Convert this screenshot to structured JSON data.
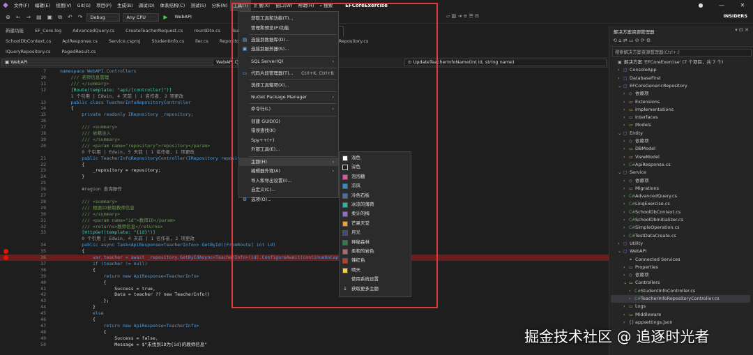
{
  "menubar": {
    "items": [
      "文件(F)",
      "编辑(E)",
      "视图(V)",
      "Git(G)",
      "项目(P)",
      "生成(B)",
      "调试(D)",
      "体系结构(C)",
      "测试(S)",
      "分析(N)",
      "工具(T)",
      "扩展(X)",
      "窗口(W)",
      "帮助(H)"
    ],
    "search": "搜索",
    "title": "EFCoreExercise"
  },
  "toolbar": {
    "config": "Debug",
    "platform": "Any CPU",
    "project": "WebAPI",
    "insiders": "INSIDERS"
  },
  "tabs_row1": [
    "新建功能",
    "EF_Core.log",
    "AdvancedQuery.cs",
    "CreateTeacherRequest.cs",
    "rountDto.cs",
    "TeacherInfo.cs",
    "TeacherInfoR...Controller.cs"
  ],
  "tabs_row2": [
    "SchoolDbContext.cs",
    "ApiResponse.cs",
    "Service.csproj",
    "StudentInfo.cs",
    "ller.cs",
    "Repository.cs",
    "ServiceCollec...Extensions.cs",
    "IRepository.cs"
  ],
  "tabs_row3": [
    "IQueryRepository.cs",
    "PagedResult.cs"
  ],
  "navbar": {
    "project": "WebAPI",
    "class": "WebAPI.C",
    "member": "UpdateTeacherInfoName(int id, string name)"
  },
  "code_lines": [
    {
      "n": "7",
      "t": "namespace WebAPI.Controllers"
    },
    {
      "n": "10",
      "t": "    /// 老师信息管理"
    },
    {
      "n": "11",
      "t": "    /// </summary>"
    },
    {
      "n": "12",
      "t": "    [Route(template: \"api/[controller]\")]"
    },
    {
      "n": "",
      "t": "    1 个引用 | Edwin, 4 天前 | 1 名作者, 2 项更改"
    },
    {
      "n": "13",
      "t": "    public class TeacherInfoRepositoryController"
    },
    {
      "n": "14",
      "t": "    {"
    },
    {
      "n": "15",
      "t": "        private readonly IRepository _repository;"
    },
    {
      "n": "16",
      "t": ""
    },
    {
      "n": "17",
      "t": "        /// <summary>"
    },
    {
      "n": "18",
      "t": "        /// 依赖注入"
    },
    {
      "n": "19",
      "t": "        /// </summary>"
    },
    {
      "n": "20",
      "t": "        /// <param name=\"repository\">repository</param>"
    },
    {
      "n": "",
      "t": "        0 个引用 | Edwin, 5 天前 | 1 名作者, 1 项更改"
    },
    {
      "n": "21",
      "t": "        public TeacherInfoRepositoryController(IRepository repository"
    },
    {
      "n": "22",
      "t": "        {"
    },
    {
      "n": "23",
      "t": "            _repository = repository;"
    },
    {
      "n": "24",
      "t": "        }"
    },
    {
      "n": "25",
      "t": ""
    },
    {
      "n": "26",
      "t": "        #region 查询操作"
    },
    {
      "n": "27",
      "t": ""
    },
    {
      "n": "28",
      "t": "        /// <summary>"
    },
    {
      "n": "29",
      "t": "        /// 根据ID获取教师信息"
    },
    {
      "n": "30",
      "t": "        /// </summary>"
    },
    {
      "n": "31",
      "t": "        /// <param name=\"id\">教师ID</param>"
    },
    {
      "n": "32",
      "t": "        /// <returns>教师信息</returns>"
    },
    {
      "n": "33",
      "t": "        [HttpGet(template: \"{id}\")]"
    },
    {
      "n": "",
      "t": "        0 个引用 | Edwin, 4 天前 | 1 名作者, 2 项更改"
    },
    {
      "n": "34",
      "t": "        public async Task<ApiResponse<TeacherInfo>> GetById([FromRoute] int id)"
    },
    {
      "n": "35",
      "t": "        {"
    },
    {
      "n": "36",
      "t": "            var teacher = await _repository.GetByIdAsync<TeacherInfo>(id).ConfigureAwait(continueOnCapturedContext: false);"
    },
    {
      "n": "37",
      "t": "            if (teacher != null)"
    },
    {
      "n": "38",
      "t": "            {"
    },
    {
      "n": "39",
      "t": "                return new ApiResponse<TeacherInfo>"
    },
    {
      "n": "40",
      "t": "                {"
    },
    {
      "n": "41",
      "t": "                    Success = true,"
    },
    {
      "n": "42",
      "t": "                    Data = teacher ?? new TeacherInfo()"
    },
    {
      "n": "43",
      "t": "                };"
    },
    {
      "n": "44",
      "t": "            }"
    },
    {
      "n": "45",
      "t": "            else"
    },
    {
      "n": "46",
      "t": "            {"
    },
    {
      "n": "47",
      "t": "                return new ApiResponse<TeacherInfo>"
    },
    {
      "n": "48",
      "t": "                {"
    },
    {
      "n": "49",
      "t": "                    Success = false,"
    },
    {
      "n": "50",
      "t": "                    Message = $\"未找到ID为{id}的教师信息\""
    }
  ],
  "tools_menu": [
    {
      "label": "获取工具和功能(T)...",
      "sc": ""
    },
    {
      "label": "管理和预览(P)功能",
      "sc": ""
    },
    {
      "sep": true
    },
    {
      "label": "连接到数据库(D)...",
      "sc": ""
    },
    {
      "label": "连接到服务器(S)...",
      "sc": ""
    },
    {
      "sep": true
    },
    {
      "label": "SQL Server(Q)",
      "sc": "›"
    },
    {
      "sep": true
    },
    {
      "label": "代码片段管理器(T)...",
      "sc": "Ctrl+K, Ctrl+B"
    },
    {
      "sep": true
    },
    {
      "label": "选择工具箱项(X)...",
      "sc": ""
    },
    {
      "sep": true
    },
    {
      "label": "NuGet Package Manager",
      "sc": "›"
    },
    {
      "sep": true
    },
    {
      "label": "命令行(L)",
      "sc": "›"
    },
    {
      "sep": true
    },
    {
      "label": "创建 GUID(G)",
      "sc": ""
    },
    {
      "label": "错误查找(K)",
      "sc": ""
    },
    {
      "label": "Spy++(+)",
      "sc": ""
    },
    {
      "label": "外部工具(E)...",
      "sc": ""
    },
    {
      "sep": true
    },
    {
      "label": "主题(H)",
      "sc": "›"
    },
    {
      "label": "编辑器外观(A)",
      "sc": "›"
    },
    {
      "label": "导入和导出设置(I)...",
      "sc": ""
    },
    {
      "label": "自定义(C)...",
      "sc": ""
    },
    {
      "label": "选项(O)...",
      "sc": ""
    }
  ],
  "theme_submenu": [
    {
      "label": "浅色",
      "color": "#ffffff"
    },
    {
      "label": "深色",
      "color": "#1e1e1e"
    },
    {
      "label": "泡泡糖",
      "color": "#e0559f"
    },
    {
      "label": "凉风",
      "color": "#2f8ec7"
    },
    {
      "label": "冷色石板",
      "color": "#4a6fa5"
    },
    {
      "label": "冰凉的薄荷",
      "color": "#2bb5a0"
    },
    {
      "label": "柔计的梅",
      "color": "#8f6fc8"
    },
    {
      "label": "芒果天堂",
      "color": "#f0a330"
    },
    {
      "label": "月光",
      "color": "#3a4a7a"
    },
    {
      "label": "神秘森林",
      "color": "#2e7d4f"
    },
    {
      "label": "柔和的岩色",
      "color": "#b06a6a"
    },
    {
      "label": "辣红色",
      "color": "#c0392b"
    },
    {
      "label": "晴天",
      "color": "#f5d142"
    },
    {
      "label": "使用系统设置",
      "color": ""
    },
    {
      "label": "获取更多主题",
      "color": ""
    }
  ],
  "solution": {
    "title": "解决方案资源管理器",
    "search": "搜索解决方案资源管理器(Ctrl+;)",
    "items": [
      {
        "d": 0,
        "c": "",
        "i": "▣",
        "label": "解决方案 'EFCoreExercise' (7 个项目，共 7 个)"
      },
      {
        "d": 1,
        "c": "›",
        "i": "▢",
        "label": "ConsoleApp"
      },
      {
        "d": 1,
        "c": "›",
        "i": "▢",
        "label": "DatabaseFirst"
      },
      {
        "d": 1,
        "c": "⌄",
        "i": "▢",
        "label": "EFCoreGenericRepository"
      },
      {
        "d": 2,
        "c": "›",
        "i": "◇",
        "label": "依赖项"
      },
      {
        "d": 2,
        "c": "›",
        "i": "▭",
        "label": "Extensions"
      },
      {
        "d": 2,
        "c": "›",
        "i": "▭",
        "label": "Implementations"
      },
      {
        "d": 2,
        "c": "›",
        "i": "▭",
        "label": "Interfaces"
      },
      {
        "d": 2,
        "c": "›",
        "i": "▭",
        "label": "Models"
      },
      {
        "d": 1,
        "c": "⌄",
        "i": "▢",
        "label": "Entity"
      },
      {
        "d": 2,
        "c": "›",
        "i": "◇",
        "label": "依赖项"
      },
      {
        "d": 2,
        "c": "›",
        "i": "▭",
        "label": "DBModel"
      },
      {
        "d": 2,
        "c": "›",
        "i": "▭",
        "label": "ViewModel"
      },
      {
        "d": 2,
        "c": "›",
        "i": "C#",
        "label": "ApiResponse.cs"
      },
      {
        "d": 1,
        "c": "⌄",
        "i": "▢",
        "label": "Service"
      },
      {
        "d": 2,
        "c": "›",
        "i": "◇",
        "label": "依赖项"
      },
      {
        "d": 2,
        "c": "›",
        "i": "▭",
        "label": "Migrations"
      },
      {
        "d": 2,
        "c": "›",
        "i": "C#",
        "label": "AdvancedQuery.cs"
      },
      {
        "d": 2,
        "c": "›",
        "i": "C#",
        "label": "LinqExercise.cs"
      },
      {
        "d": 2,
        "c": "›",
        "i": "C#",
        "label": "SchoolDbContext.cs"
      },
      {
        "d": 2,
        "c": "›",
        "i": "C#",
        "label": "SchoolDbInitializer.cs"
      },
      {
        "d": 2,
        "c": "›",
        "i": "C#",
        "label": "SimpleOperation.cs"
      },
      {
        "d": 2,
        "c": "›",
        "i": "C#",
        "label": "TestDataCreate.cs"
      },
      {
        "d": 1,
        "c": "›",
        "i": "▢",
        "label": "Utility"
      },
      {
        "d": 1,
        "c": "⌄",
        "i": "▢",
        "label": "WebAPI"
      },
      {
        "d": 2,
        "c": "",
        "i": "⚭",
        "label": "Connected Services"
      },
      {
        "d": 2,
        "c": "›",
        "i": "▭",
        "label": "Properties"
      },
      {
        "d": 2,
        "c": "›",
        "i": "◇",
        "label": "依赖项"
      },
      {
        "d": 2,
        "c": "⌄",
        "i": "▭",
        "label": "Controllers"
      },
      {
        "d": 3,
        "c": "›",
        "i": "C#",
        "label": "StudentInfoController.cs"
      },
      {
        "d": 3,
        "c": "›",
        "i": "C#",
        "label": "TeacherInfoRepositoryController.cs",
        "sel": true
      },
      {
        "d": 2,
        "c": "›",
        "i": "▭",
        "label": "Logs"
      },
      {
        "d": 2,
        "c": "›",
        "i": "▭",
        "label": "Middleware"
      },
      {
        "d": 2,
        "c": "›",
        "i": "{}",
        "label": "appsettings.json"
      }
    ]
  },
  "watermark": "掘金技术社区 @ 追逐时光者",
  "colors": {
    "accent": "#b180d7",
    "highlight": "#e03c3c",
    "keyword": "#569cd6",
    "type": "#4ec9b0",
    "comment": "#6a9955",
    "string": "#ce9178"
  }
}
